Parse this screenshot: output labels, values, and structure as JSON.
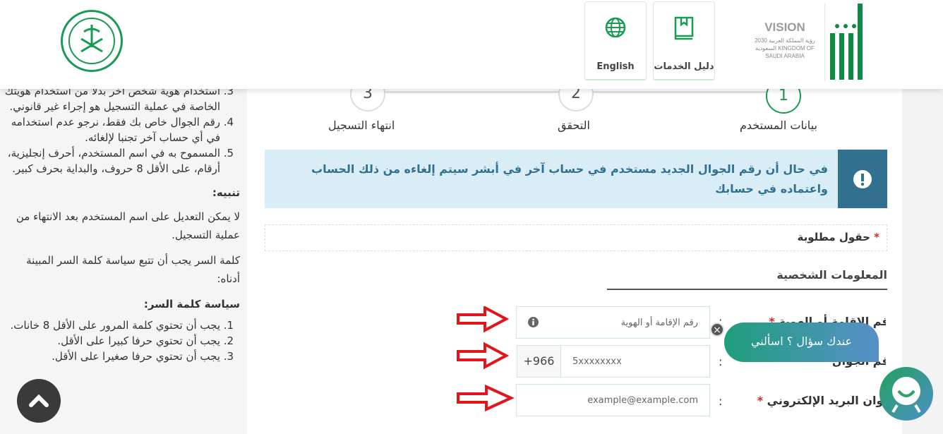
{
  "header": {
    "services_guide_label": "دليل الخدمات",
    "english_label": "English",
    "vision_logo_text": "VISION 2030 رؤية المملكة العربية السعودية KINGDOM OF SAUDI ARABIA",
    "absher_logo_text": "أبشر",
    "brand_color": "#0f8a45"
  },
  "steps": [
    {
      "number": "1",
      "label": "بيانات المستخدم",
      "active": true
    },
    {
      "number": "2",
      "label": "التحقق",
      "active": false
    },
    {
      "number": "3",
      "label": "انتهاء التسجيل",
      "active": false
    }
  ],
  "alert": {
    "text": "في حال أن رقم الجوال الجديد مستخدم في حساب آخر في أبشر سيتم إلغاءه من ذلك الحساب واعتماده في حسابك",
    "icon": "exclamation-icon"
  },
  "required_note": {
    "star": "*",
    "text": "حقول مطلوبة"
  },
  "section_title": "المعلومات الشخصية",
  "form": {
    "id_label": "رقم الإقامة أو الهوية",
    "id_placeholder": "رقم الإقامة أو الهوية",
    "mobile_label": "رقم الجوال",
    "mobile_prefix": "+966",
    "mobile_placeholder": "5xxxxxxxx",
    "email_label": "عنوان البريد الإلكتروني",
    "email_placeholder": "example@example.com",
    "colon": ":",
    "star": "*"
  },
  "chat": {
    "bubble": "عندك سؤال ؟ اسألني",
    "close": "×"
  },
  "sidebar": {
    "list1": [
      "استخدام هوية شخص آخر بدلا من استخدام هويتك الخاصة في عملية التسجيل هو إجراء غير قانوني.",
      "رقم الجوال خاص بك فقط، نرجو عدم استخدامه في أي حساب آخر تجنبا لإلغائه.",
      "المسموح به في اسم المستخدم، أحرف إنجليزية، أرقام، على الأقل 8 حروف، والبداية بحرف كبير."
    ],
    "notice_title": "تنبيه:",
    "notice_text": "لا يمكن التعديل على اسم المستخدم بعد الانتهاء من عملية التسجيل.",
    "policy_intro": "كلمة السر يجب أن تتبع سياسة كلمة السر المبينة أدناه:",
    "policy_title": "سياسة كلمة السر:",
    "policy": [
      "يجب أن تحتوي كلمة المرور على الأقل 8 خانات.",
      "يجب أن تحتوي حرفا كبيرا على الأقل.",
      "يجب أن تحتوي حرفا صغيرا على الأقل."
    ]
  }
}
